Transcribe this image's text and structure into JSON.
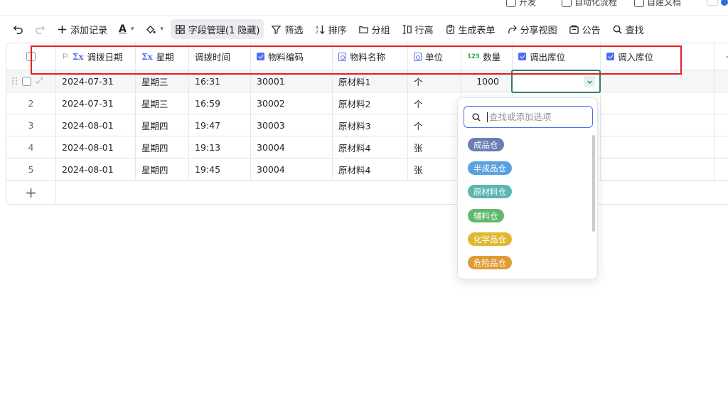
{
  "topbar": {
    "items": [
      "开发",
      "自动化流程",
      "自建文档"
    ]
  },
  "toolbar": {
    "add_record": "添加记录",
    "text_color": "A",
    "field_manage": "字段管理(1 隐藏)",
    "filter": "筛选",
    "sort": "排序",
    "group": "分组",
    "row_height": "行高",
    "gen_form": "生成表单",
    "share_view": "分享视图",
    "notice": "公告",
    "find": "查找"
  },
  "columns": [
    {
      "label": "调拨日期",
      "type": "formula"
    },
    {
      "label": "星期",
      "type": "formula"
    },
    {
      "label": "调拨时间",
      "type": "text"
    },
    {
      "label": "物料编码",
      "type": "select"
    },
    {
      "label": "物料名称",
      "type": "link"
    },
    {
      "label": "单位",
      "type": "link"
    },
    {
      "label": "数量",
      "type": "number",
      "icon_text": "123"
    },
    {
      "label": "调出库位",
      "type": "select"
    },
    {
      "label": "调入库位",
      "type": "select"
    }
  ],
  "rows": [
    {
      "index": "1",
      "date": "2024-07-31",
      "weekday": "星期三",
      "time": "16:31",
      "code": "30001",
      "name": "原材料1",
      "unit": "个",
      "qty": "1000"
    },
    {
      "index": "2",
      "date": "2024-07-31",
      "weekday": "星期三",
      "time": "16:59",
      "code": "30002",
      "name": "原材料2",
      "unit": "个",
      "qty": ""
    },
    {
      "index": "3",
      "date": "2024-08-01",
      "weekday": "星期四",
      "time": "19:47",
      "code": "30003",
      "name": "原材料3",
      "unit": "个",
      "qty": ""
    },
    {
      "index": "4",
      "date": "2024-08-01",
      "weekday": "星期四",
      "time": "19:13",
      "code": "30004",
      "name": "原材料4",
      "unit": "张",
      "qty": ""
    },
    {
      "index": "5",
      "date": "2024-08-01",
      "weekday": "星期四",
      "time": "19:45",
      "code": "30004",
      "name": "原材料4",
      "unit": "张",
      "qty": ""
    }
  ],
  "dropdown": {
    "search_placeholder": "查找或添加选项",
    "options": [
      {
        "label": "成品仓",
        "color": "#6a7fb5"
      },
      {
        "label": "半成品仓",
        "color": "#5aa0e0"
      },
      {
        "label": "原材料仓",
        "color": "#5bb5b0"
      },
      {
        "label": "辅料仓",
        "color": "#5fb86b"
      },
      {
        "label": "化学品仓",
        "color": "#e0b830"
      },
      {
        "label": "危险品仓",
        "color": "#e09a35"
      }
    ]
  },
  "colors": {
    "accent": "#4e6ef2",
    "active_cell_border": "#2e7d6c",
    "highlight_box": "#e02020"
  }
}
